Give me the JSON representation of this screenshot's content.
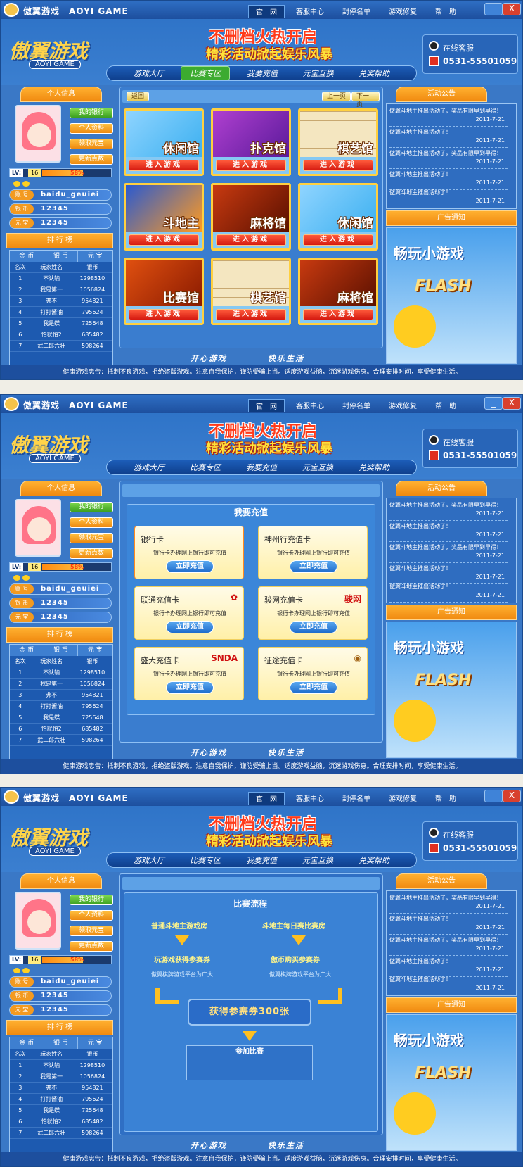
{
  "app": {
    "title_cn": "傲翼游戏",
    "title_en": "AOYI GAME"
  },
  "topnav": [
    "官　网",
    "客服中心",
    "封停名单",
    "游戏修复",
    "帮　助"
  ],
  "window_buttons": {
    "minimize": "_",
    "close": "X"
  },
  "logo": {
    "cn": "傲翼游戏",
    "en": "AOYI GAME"
  },
  "banner": {
    "line1": "不删档火热开启",
    "line2": "精彩活动掀起娱乐风暴"
  },
  "support": {
    "label": "在线客服",
    "phone": "0531-55501059"
  },
  "mainnav": [
    "游戏大厅",
    "比赛专区",
    "我要充值",
    "元宝互换",
    "兑奖帮助"
  ],
  "profile": {
    "title": "个人信息",
    "buttons": [
      "我的银行",
      "个人资料",
      "领取元宝",
      "更新点数"
    ],
    "level_tag": "LV:",
    "level": "16",
    "exp_pct": "58%",
    "exp_fraction": 0.58,
    "rows": [
      {
        "icon": "账 号",
        "value": "baidu_geuiei"
      },
      {
        "icon": "银 币",
        "value": "12345"
      },
      {
        "icon": "元 宝",
        "value": "12345"
      }
    ]
  },
  "ranking": {
    "title": "排 行 榜",
    "tabs": [
      "金 币",
      "银 币",
      "元 宝"
    ],
    "headers": [
      "名次",
      "玩家姓名",
      "银币"
    ],
    "rows": [
      [
        "1",
        "不认输",
        "1298510"
      ],
      [
        "2",
        "我是第一",
        "1056824"
      ],
      [
        "3",
        "弗不",
        "954821"
      ],
      [
        "4",
        "打打酱油",
        "795624"
      ],
      [
        "5",
        "我是蝶",
        "725648"
      ],
      [
        "6",
        "怕就怕2",
        "685482"
      ],
      [
        "7",
        "武二郎六壮",
        "598264"
      ]
    ]
  },
  "lobby": {
    "back": "返回",
    "prev": "上一页",
    "next": "下一页",
    "enter": "进入游戏",
    "games": [
      "休闲馆",
      "扑克馆",
      "棋艺馆",
      "斗地主",
      "麻将馆",
      "休闲馆",
      "比赛馆",
      "棋艺馆",
      "麻将馆"
    ]
  },
  "slogans": [
    "开心游戏",
    "快乐生活"
  ],
  "news": {
    "title": "活动公告",
    "items": [
      {
        "text": "傲翼斗地主推出活动了，奖品有限早到早得！",
        "date": "2011-7-21"
      },
      {
        "text": "傲翼斗地主推出活动了！",
        "date": "2011-7-21"
      },
      {
        "text": "傲翼斗地主推出活动了，奖品有限早到早得！",
        "date": "2011-7-21"
      },
      {
        "text": "傲翼斗地主推出活动了！",
        "date": "2011-7-21"
      },
      {
        "text": "傲翼斗地主推出活动了！",
        "date": "2011-7-21"
      }
    ]
  },
  "ad": {
    "title": "广告通知",
    "line1": "畅玩小游戏",
    "line2": "FLASH"
  },
  "footer": "健康游戏忠告：抵制不良游戏，拒绝盗版游戏。注意自我保护，谨防受骗上当。适度游戏益脑，沉迷游戏伤身。合理安排时间，享受健康生活。",
  "recharge": {
    "title": "我要充值",
    "desc": "银行卡办理网上银行即可充值",
    "button": "立即充值",
    "cards": [
      {
        "name": "银行卡",
        "logo": ""
      },
      {
        "name": "神州行充值卡",
        "logo": ""
      },
      {
        "name": "联通充值卡",
        "logo": ""
      },
      {
        "name": "骏网充值卡",
        "logo": "骏网"
      },
      {
        "name": "盛大充值卡",
        "logo": "SNDA"
      },
      {
        "name": "征途充值卡",
        "logo": ""
      }
    ]
  },
  "contest": {
    "title": "比赛流程",
    "left_step1": "普通斗地主游戏房",
    "right_step1": "斗地主每日赛比赛房",
    "left_step2": "玩游戏获得参赛券",
    "right_step2": "傲币购买参赛券",
    "note": "傲翼棋牌游戏平台为广大",
    "ticket": "获得参赛券300张",
    "join": "参加比赛"
  }
}
